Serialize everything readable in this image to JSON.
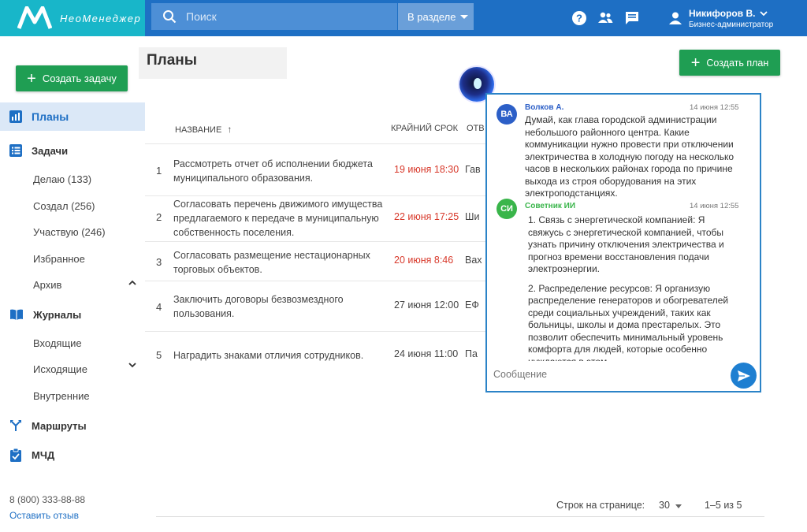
{
  "header": {
    "logo_text": "НеоМенеджер",
    "search_placeholder": "Поиск",
    "section_label": "В разделе",
    "icons": [
      "help-icon",
      "users-icon",
      "chat-icon"
    ],
    "user": {
      "name": "Никифоров В.",
      "role": "Бизнес-администратор"
    }
  },
  "sidebar": {
    "create_task": "Создать задачу",
    "plans": "Планы",
    "tasks": {
      "label": "Задачи",
      "items": [
        "Делаю (133)",
        "Создал (256)",
        "Участвую (246)",
        "Избранное",
        "Архив"
      ]
    },
    "journals": {
      "label": "Журналы",
      "items": [
        "Входящие",
        "Исходящие",
        "Внутренние"
      ]
    },
    "routes": "Маршруты",
    "mchd": "МЧД",
    "phone": "8 (800) 333-88-88",
    "feedback": "Оставить отзыв"
  },
  "main": {
    "title": "Планы",
    "create_plan": "Создать план",
    "columns": {
      "name": "НАЗВАНИЕ",
      "deadline": "КРАЙНИЙ СРОК",
      "responsible": "ОТВ"
    },
    "rows": [
      {
        "num": "1",
        "name": "Рассмотреть отчет об исполнении бюджета муниципального образования.",
        "date": "19 июня 18:30",
        "overdue": true,
        "resp": "Гав"
      },
      {
        "num": "2",
        "name": "Согласовать перечень движимого имущества предлагаемого к передаче в муниципальную собственность поселения.",
        "date": "22 июня 17:25",
        "overdue": true,
        "resp": "Ши"
      },
      {
        "num": "3",
        "name": "Согласовать размещение нестационарных торговых объектов.",
        "date": "20 июня 8:46",
        "overdue": true,
        "resp": "Вах"
      },
      {
        "num": "4",
        "name": "Заключить договоры безвозмездного пользования.",
        "date": "27 июня 12:00",
        "overdue": false,
        "resp": "ЕФ"
      },
      {
        "num": "5",
        "name": "Наградить знаками отличия сотрудников.",
        "date": "24 июня 11:00",
        "overdue": false,
        "resp": "Па"
      }
    ],
    "footer": {
      "rows_per_page_label": "Строк на странице:",
      "rows_per_page": "30",
      "range": "1–5 из 5"
    }
  },
  "chat": {
    "messages": [
      {
        "initials": "ВА",
        "author": "Волков А.",
        "time": "14 июня 12:55",
        "text": "Думай, как глава городской администрации небольшого районного центра. Какие коммуникации нужно провести при отключении электричества в холодную погоду на несколько часов в нескольких районах города по причине выхода из строя оборудования на этих электроподстанциях."
      },
      {
        "initials": "СИ",
        "author": "Советник ИИ",
        "time": "14 июня 12:55",
        "p1": "1. Связь с энергетической компанией: Я свяжусь с энергетической компанией, чтобы узнать причину отключения электричества и прогноз времени восстановления подачи электроэнергии.",
        "p2": "2. Распределение ресурсов: Я организую распределение генераторов и обогревателей среди социальных учреждений, таких как больницы, школы и дома престарелых. Это позволит обеспечить минимальный уровень комфорта для людей, которые особенно нуждаются в этом."
      }
    ],
    "input_placeholder": "Сообщение"
  },
  "colors": {
    "header": "#1e6fc4",
    "logo_bg": "#18b6c9",
    "accent_green": "#1f9e53",
    "overdue": "#d8392b",
    "user_avatar": "#2c5fc7",
    "ai_avatar": "#39b54a"
  }
}
